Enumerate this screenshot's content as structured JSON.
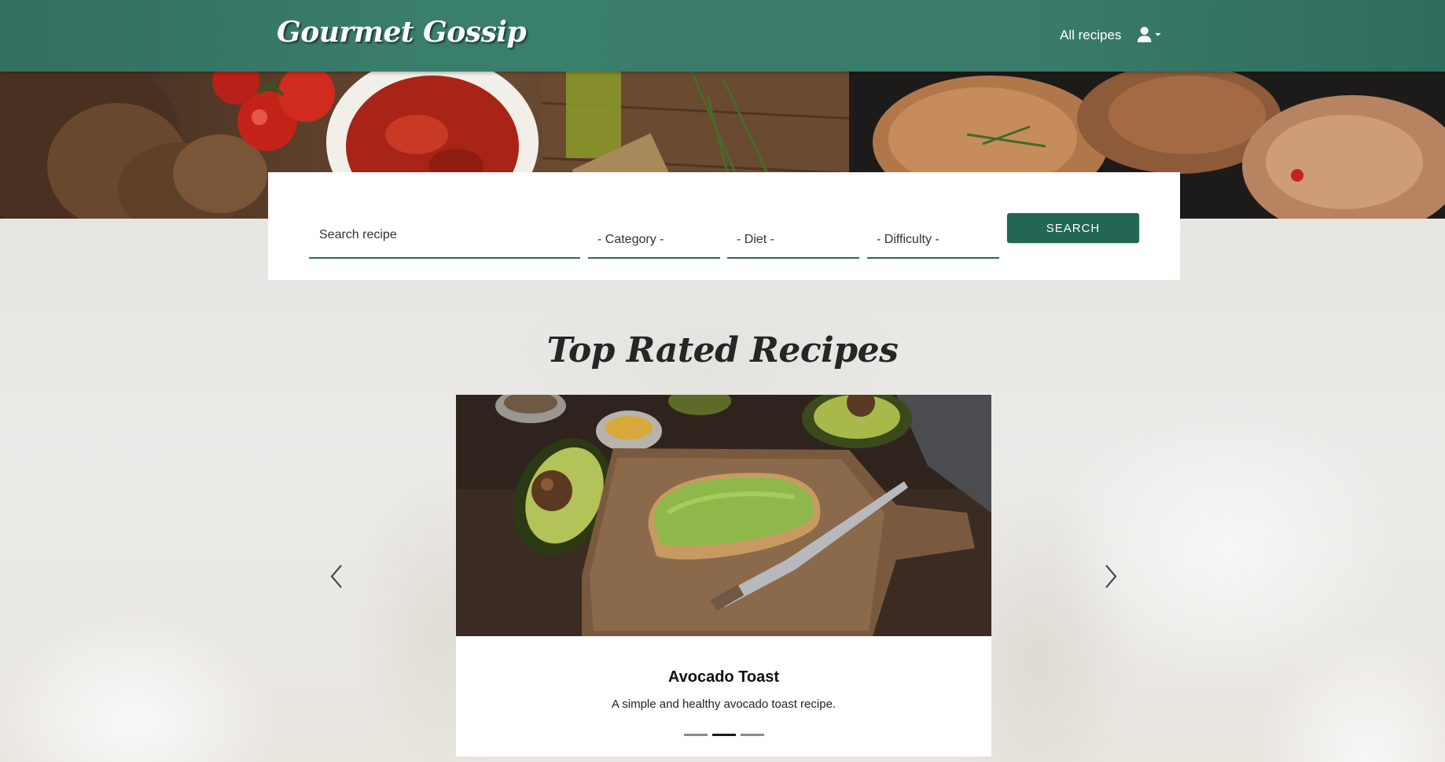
{
  "header": {
    "brand": "Gourmet Gossip",
    "nav_all_recipes": "All recipes",
    "user_icon": "user-icon",
    "dropdown_icon": "caret-down-icon"
  },
  "search": {
    "placeholder": "Search recipe",
    "category": "- Category -",
    "diet": "- Diet -",
    "difficulty": "- Difficulty -",
    "button_label": "SEARCH"
  },
  "top_rated": {
    "title": "Top Rated Recipes",
    "current": {
      "title": "Avocado Toast",
      "description": "A simple and healthy avocado toast recipe."
    },
    "indicator_count": 3,
    "active_indicator": 2,
    "prev_icon": "chevron-left-icon",
    "next_icon": "chevron-right-icon"
  },
  "colors": {
    "brand_green": "#3a7e6c",
    "button_green": "#226653",
    "underline_green": "#2b6a5a"
  }
}
